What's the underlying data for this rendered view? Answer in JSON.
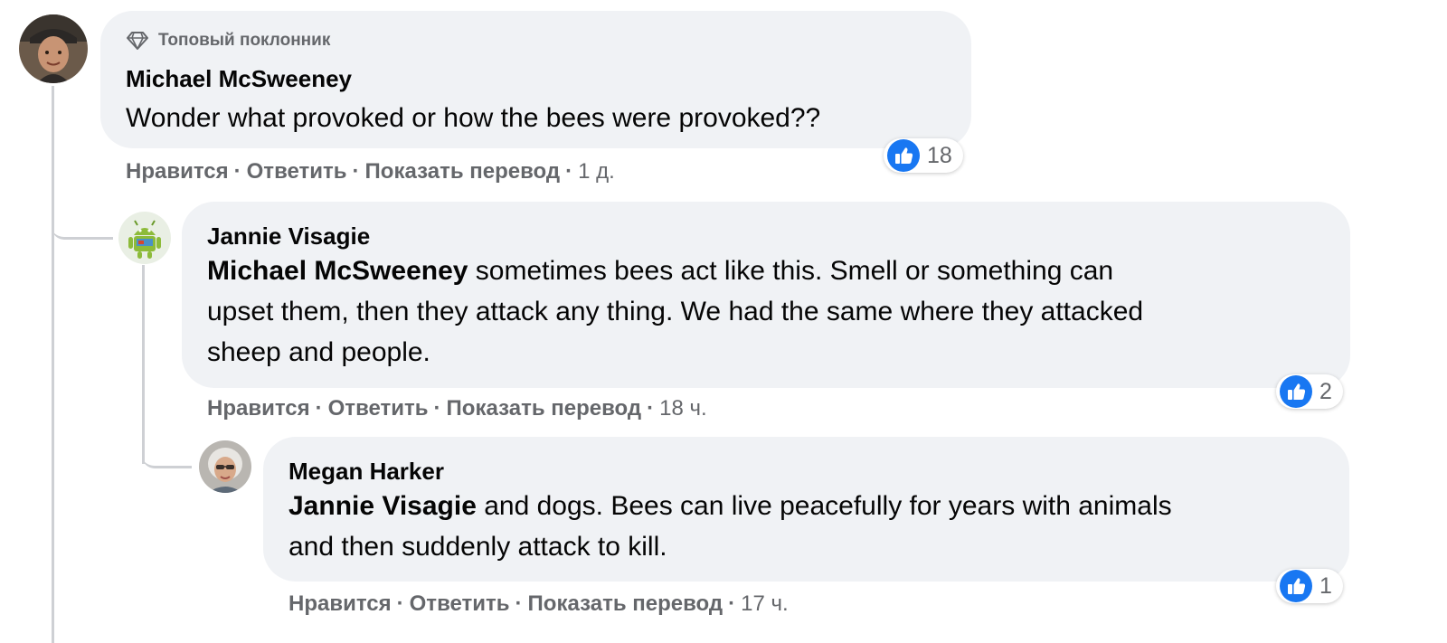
{
  "comments": [
    {
      "badge": "Топовый поклонник",
      "author": "Michael McSweeney",
      "mention": "",
      "text": "Wonder what provoked or how the bees were provoked??",
      "reactions": "18",
      "actions": {
        "like": "Нравится",
        "reply": "Ответить",
        "translate": "Показать перевод",
        "time": "1 д."
      }
    },
    {
      "author": "Jannie Visagie",
      "mention": "Michael McSweeney",
      "text_line1": " sometimes bees act like this. Smell or something can",
      "text_line2": "upset them, then they attack any thing. We had the same where they attacked",
      "text_line3": "sheep and people.",
      "reactions": "2",
      "actions": {
        "like": "Нравится",
        "reply": "Ответить",
        "translate": "Показать перевод",
        "time": "18 ч."
      }
    },
    {
      "author": "Megan Harker",
      "mention": "Jannie Visagie",
      "text_line1": " and dogs. Bees can live peacefully for years with animals",
      "text_line2": "and then suddenly attack to kill.",
      "reactions": "1",
      "actions": {
        "like": "Нравится",
        "reply": "Ответить",
        "translate": "Показать перевод",
        "time": "17 ч."
      }
    }
  ],
  "separator": "·",
  "icons": {
    "badge": "diamond-icon",
    "reaction": "like-icon"
  },
  "colors": {
    "bubble": "#f0f2f5",
    "like_blue": "#1877f2",
    "secondary_text": "#65676b",
    "thread": "#ced0d4"
  }
}
